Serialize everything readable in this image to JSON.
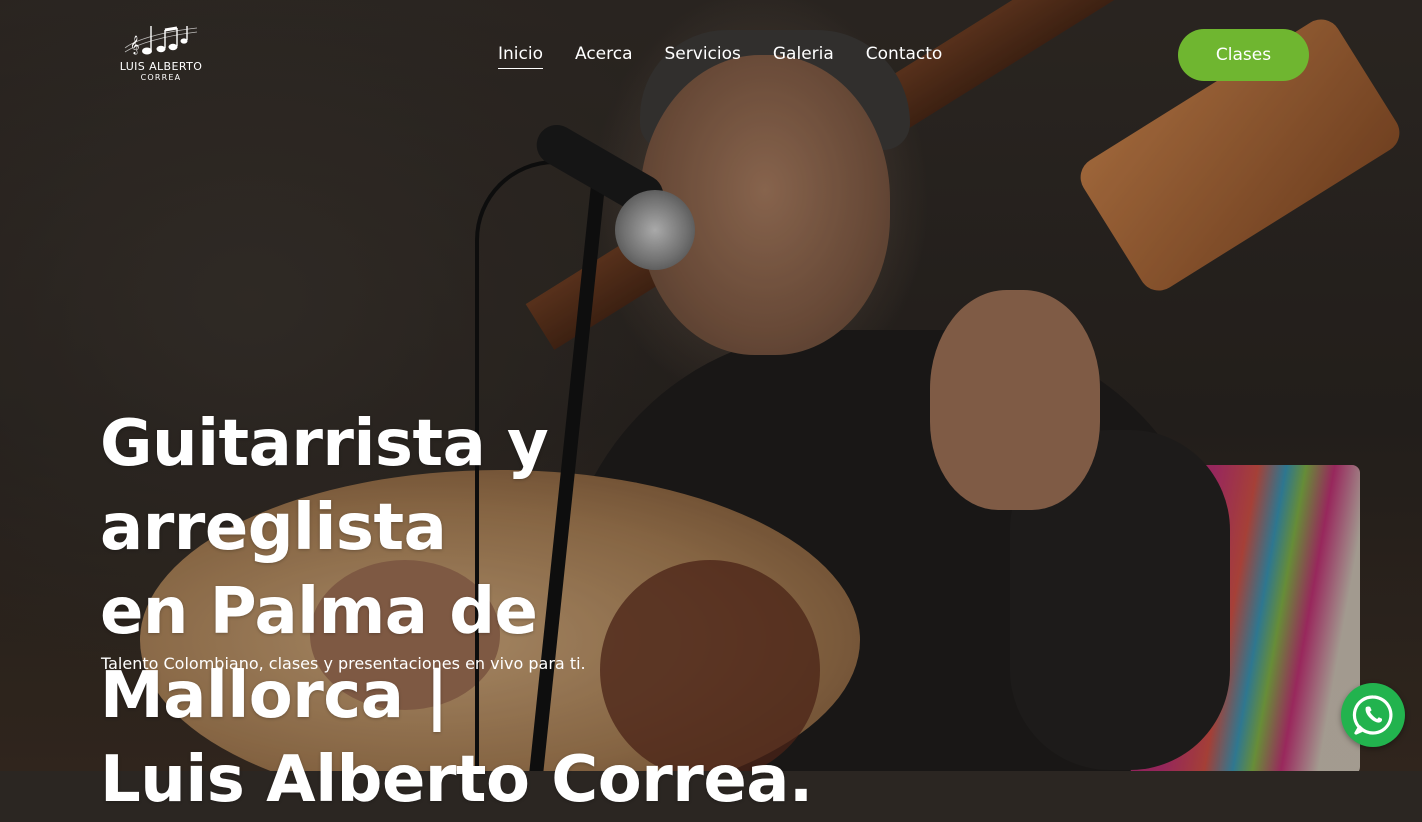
{
  "brand": {
    "name_line1": "LUIS ALBERTO",
    "name_line2": "CORREA"
  },
  "nav": {
    "items": [
      {
        "label": "Inicio",
        "active": true
      },
      {
        "label": "Acerca"
      },
      {
        "label": "Servicios"
      },
      {
        "label": "Galeria"
      },
      {
        "label": "Contacto"
      }
    ]
  },
  "cta": {
    "label": "Clases"
  },
  "hero": {
    "headline_lines": [
      "Guitarrista y arreglista",
      "en Palma de Mallorca |",
      "Luis Alberto Correa."
    ],
    "subtitle": "Talento Colombiano, clases y presentaciones en vivo para ti."
  },
  "floating": {
    "whatsapp_icon": "whatsapp-icon"
  },
  "colors": {
    "accent": "#6fb630",
    "whatsapp": "#22b34e",
    "text": "#ffffff"
  }
}
